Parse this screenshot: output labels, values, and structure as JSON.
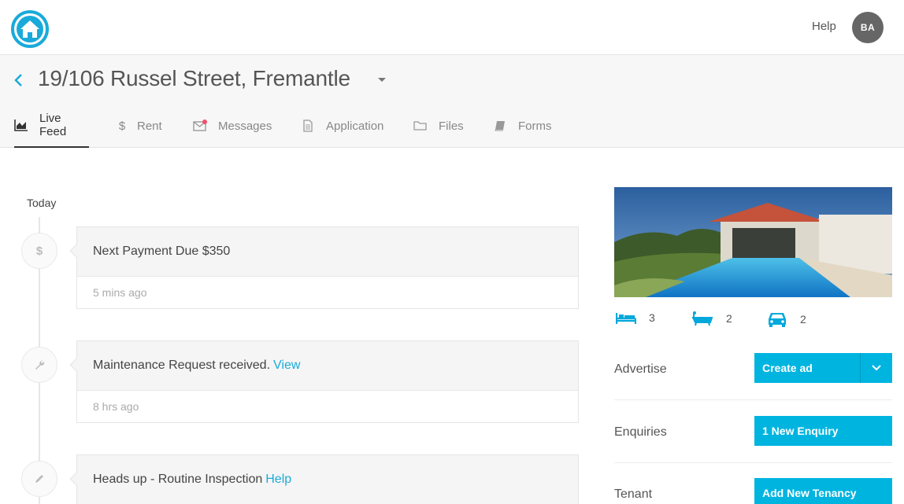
{
  "topbar": {
    "help_label": "Help",
    "avatar_initials": "BA"
  },
  "property": {
    "address": "19/106 Russel Street, Fremantle"
  },
  "tabs": [
    {
      "label": "Live Feed",
      "icon": "chart-area-icon",
      "active": true
    },
    {
      "label": "Rent",
      "icon": "dollar-icon",
      "active": false
    },
    {
      "label": "Messages",
      "icon": "envelope-icon",
      "active": false
    },
    {
      "label": "Application",
      "icon": "document-icon",
      "active": false
    },
    {
      "label": "Files",
      "icon": "folder-icon",
      "active": false
    },
    {
      "label": "Forms",
      "icon": "book-icon",
      "active": false
    }
  ],
  "feed": {
    "day_label": "Today",
    "items": [
      {
        "icon": "dollar-icon",
        "text": "Next Payment Due $350",
        "link": "",
        "time": "5 mins ago"
      },
      {
        "icon": "wrench-icon",
        "text": "Maintenance Request received.",
        "link": "View",
        "time": "8 hrs ago"
      },
      {
        "icon": "pencil-icon",
        "text": "Heads up - Routine Inspection",
        "link": "Help",
        "time": ""
      }
    ]
  },
  "features": {
    "bedrooms": "3",
    "bathrooms": "2",
    "car_spaces": "2"
  },
  "actions": {
    "advertise": {
      "label": "Advertise",
      "button": "Create ad"
    },
    "enquiries": {
      "label": "Enquiries",
      "button": "1 New Enquiry"
    },
    "tenant": {
      "label": "Tenant",
      "button": "Add New Tenancy"
    }
  },
  "colors": {
    "accent": "#00b4e0",
    "link": "#1aaad9",
    "notification_dot": "#f0506e"
  }
}
